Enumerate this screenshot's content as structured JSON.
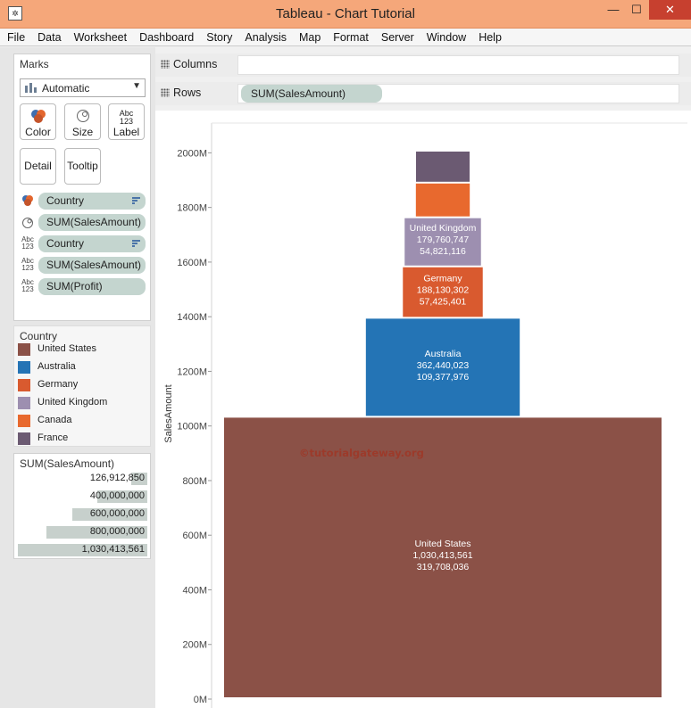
{
  "window": {
    "title": "Tableau - Chart Tutorial",
    "minimize": "—",
    "maximize": "☐",
    "close": "✕"
  },
  "menu": [
    "File",
    "Data",
    "Worksheet",
    "Dashboard",
    "Story",
    "Analysis",
    "Map",
    "Format",
    "Server",
    "Window",
    "Help"
  ],
  "marks": {
    "header": "Marks",
    "mark_type": "Automatic",
    "buttons": {
      "color": "Color",
      "size": "Size",
      "label": "Label",
      "detail": "Detail",
      "tooltip": "Tooltip"
    },
    "label_icon_text": "Abc\n123",
    "pills": [
      {
        "text": "Country",
        "icon": "color-icon",
        "sorted": true
      },
      {
        "text": "SUM(SalesAmount)",
        "icon": "size-icon",
        "sorted": false
      },
      {
        "text": "Country",
        "icon": "label-icon",
        "sorted": true
      },
      {
        "text": "SUM(SalesAmount)",
        "icon": "label-icon",
        "sorted": false
      },
      {
        "text": "SUM(Profit)",
        "icon": "label-icon",
        "sorted": false
      }
    ]
  },
  "color_legend": {
    "title": "Country",
    "items": [
      {
        "label": "United States",
        "color": "#8b5147"
      },
      {
        "label": "Australia",
        "color": "#2474b5"
      },
      {
        "label": "Germany",
        "color": "#d95a2f"
      },
      {
        "label": "United Kingdom",
        "color": "#9d8fb0"
      },
      {
        "label": "Canada",
        "color": "#e8692e"
      },
      {
        "label": "France",
        "color": "#6b5a72"
      }
    ]
  },
  "size_legend": {
    "title": "SUM(SalesAmount)",
    "rows": [
      {
        "label": "126,912,850",
        "fraction": 0.1232
      },
      {
        "label": "400,000,000",
        "fraction": 0.3882
      },
      {
        "label": "600,000,000",
        "fraction": 0.5823
      },
      {
        "label": "800,000,000",
        "fraction": 0.7764
      },
      {
        "label": "1,030,413,561",
        "fraction": 1.0
      }
    ]
  },
  "shelves": {
    "columns_label": "Columns",
    "rows_label": "Rows",
    "rows_pill": "SUM(SalesAmount)"
  },
  "chart_data": {
    "type": "bar",
    "stacked": true,
    "ylabel": "SalesAmount",
    "ylim": [
      0,
      2100
    ],
    "y_ticks": [
      0,
      200,
      400,
      600,
      800,
      1000,
      1200,
      1400,
      1600,
      1800,
      2000
    ],
    "y_tick_labels": [
      "0M",
      "200M",
      "400M",
      "600M",
      "800M",
      "1000M",
      "1200M",
      "1400M",
      "1600M",
      "1800M",
      "2000M"
    ],
    "grid": false,
    "series": [
      {
        "name": "United States",
        "sales": 1030413561,
        "sales_label": "1,030,413,561",
        "profit_label": "319,708,036",
        "color": "#8b5147"
      },
      {
        "name": "Australia",
        "sales": 362440023,
        "sales_label": "362,440,023",
        "profit_label": "109,377,976",
        "color": "#2474b5"
      },
      {
        "name": "Germany",
        "sales": 188130302,
        "sales_label": "188,130,302",
        "profit_label": "57,425,401",
        "color": "#d95a2f"
      },
      {
        "name": "United Kingdom",
        "sales": 179760747,
        "sales_label": "179,760,747",
        "profit_label": "54,821,116",
        "color": "#9d8fb0"
      },
      {
        "name": "Canada",
        "sales": 126912850,
        "sales_label": "",
        "profit_label": "",
        "color": "#e8692e"
      },
      {
        "name": "France",
        "sales": 117000000,
        "sales_label": "",
        "profit_label": "",
        "color": "#6b5a72"
      }
    ],
    "watermark": "©tutorialgateway.org"
  }
}
